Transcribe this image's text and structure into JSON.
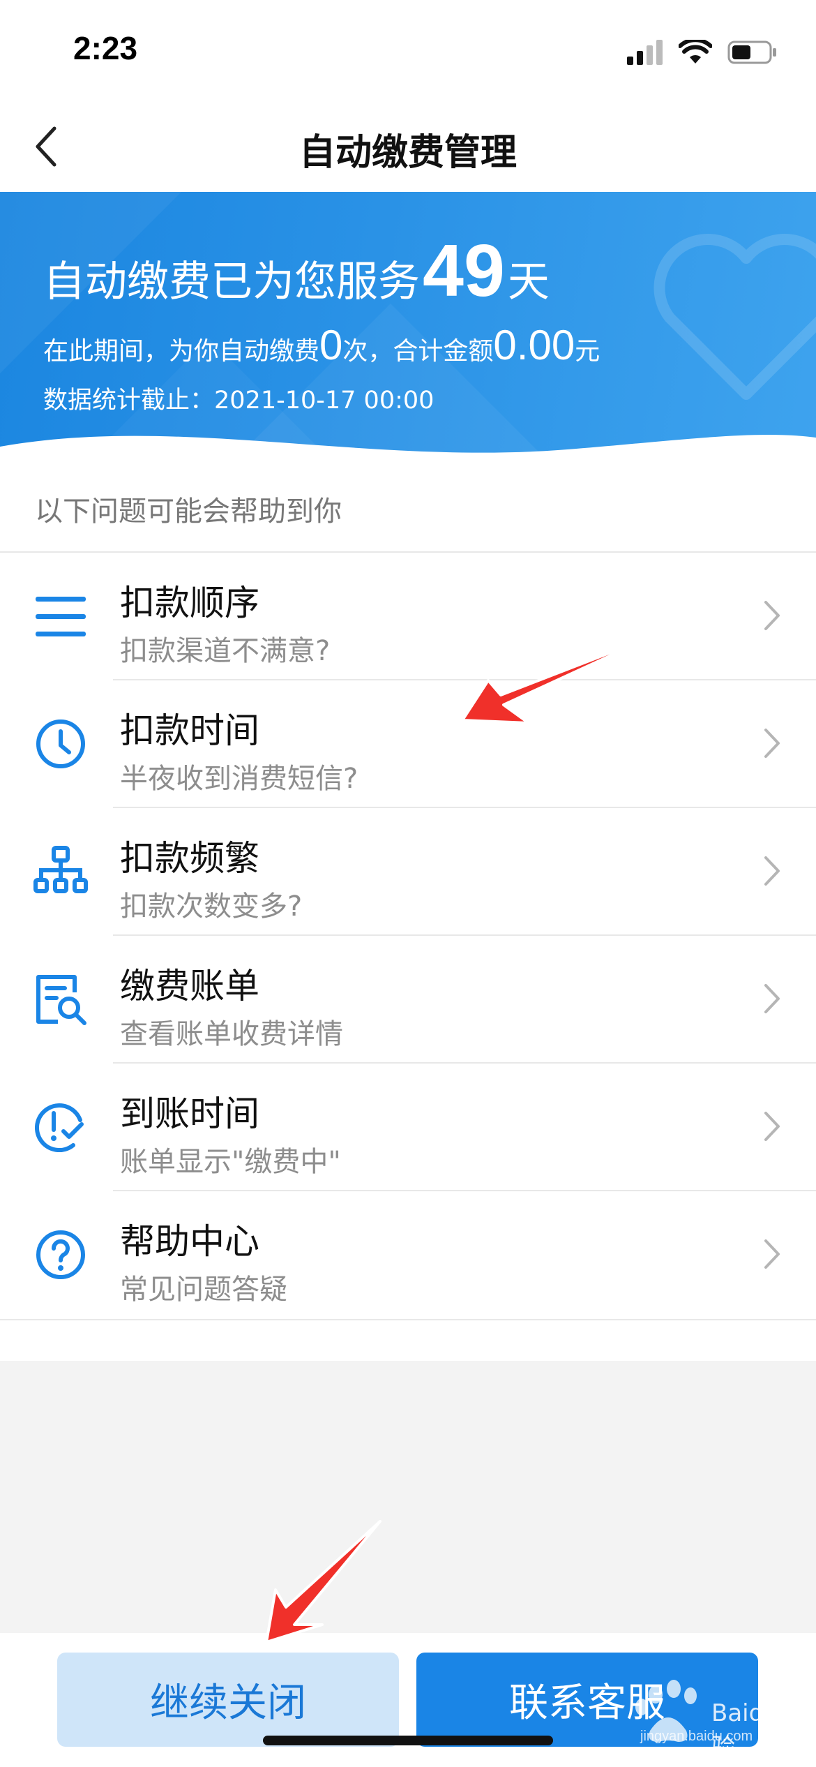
{
  "status_bar": {
    "time": "2:23",
    "icons": [
      "signal-icon",
      "wifi-icon",
      "battery-icon"
    ]
  },
  "nav": {
    "back_icon": "chevron-left-icon",
    "title": "自动缴费管理"
  },
  "banner": {
    "line1_prefix": "自动缴费已为您服务",
    "days": "49",
    "line1_suffix": "天",
    "line2_prefix": "在此期间，为你自动缴费",
    "count": "0",
    "line2_mid": "次，合计金额",
    "amount": "0.00",
    "line2_suffix": "元",
    "stats_label": "数据统计截止：",
    "stats_date": "2021-10-17 00:00",
    "deco_icon": "heart-icon"
  },
  "help": {
    "heading": "以下问题可能会帮助到你",
    "items": [
      {
        "title": "扣款顺序",
        "subtitle": "扣款渠道不满意?",
        "icon": "menu-lines-icon"
      },
      {
        "title": "扣款时间",
        "subtitle": "半夜收到消费短信?",
        "icon": "clock-icon"
      },
      {
        "title": "扣款频繁",
        "subtitle": "扣款次数变多?",
        "icon": "hierarchy-icon"
      },
      {
        "title": "缴费账单",
        "subtitle": "查看账单收费详情",
        "icon": "bill-search-icon"
      },
      {
        "title": "到账时间",
        "subtitle": "账单显示\"缴费中\"",
        "icon": "clock-check-icon"
      },
      {
        "title": "帮助中心",
        "subtitle": "常见问题答疑",
        "icon": "question-circle-icon"
      }
    ]
  },
  "buttons": {
    "continue_close": "继续关闭",
    "contact_service": "联系客服"
  },
  "watermark": {
    "brand": "Baidu",
    "suffix": "经验",
    "url": "jingyan.baidu.com"
  },
  "colors": {
    "accent": "#1a85e6",
    "banner_start": "#1b86e0",
    "banner_end": "#3ea3ee",
    "secondary_button": "#cfe5f9",
    "annotation_arrow": "#f0302a"
  }
}
